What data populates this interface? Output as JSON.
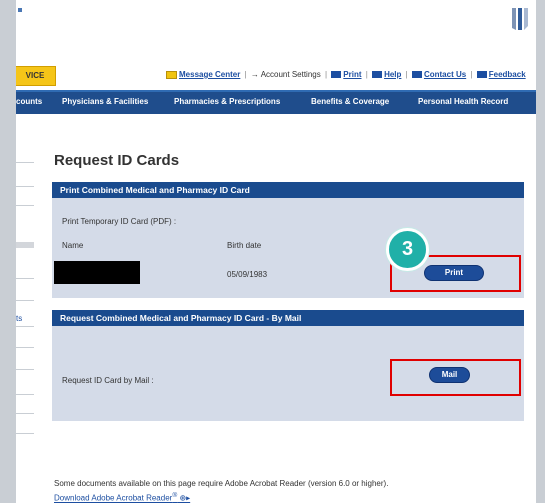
{
  "header": {
    "badge_label": "VICE",
    "links": [
      {
        "label": "Message Center",
        "icon": "envelope-icon"
      },
      {
        "label": "Account Settings",
        "icon": "arrow-icon"
      },
      {
        "label": "Print",
        "icon": "print-icon"
      },
      {
        "label": "Help",
        "icon": "help-icon"
      },
      {
        "label": "Contact Us",
        "icon": "contact-icon"
      },
      {
        "label": "Feedback",
        "icon": "feedback-icon"
      }
    ]
  },
  "nav": {
    "items": [
      "counts",
      "Physicians & Facilities",
      "Pharmacies & Prescriptions",
      "Benefits & Coverage",
      "Personal Health Record"
    ]
  },
  "sidebar": {
    "partial_link": "ts"
  },
  "main": {
    "title": "Request ID Cards",
    "print_panel": {
      "heading": "Print Combined Medical and Pharmacy ID Card",
      "temp_label": "Print Temporary ID Card (PDF) :",
      "name_header": "Name",
      "birth_header": "Birth date",
      "birth_value": "05/09/1983",
      "print_button": "Print"
    },
    "mail_panel": {
      "heading": "Request Combined Medical and Pharmacy ID Card - By Mail",
      "mail_label": "Request ID Card by Mail :",
      "mail_button": "Mail"
    },
    "footer_text": "Some documents available on this page require Adobe Acrobat Reader (version 6.0 or higher).",
    "footer_link": "Download Adobe Acrobat Reader"
  },
  "annotation": {
    "step_number": "3",
    "highlight_color": "#e00000",
    "step_color": "#20b0a8"
  }
}
